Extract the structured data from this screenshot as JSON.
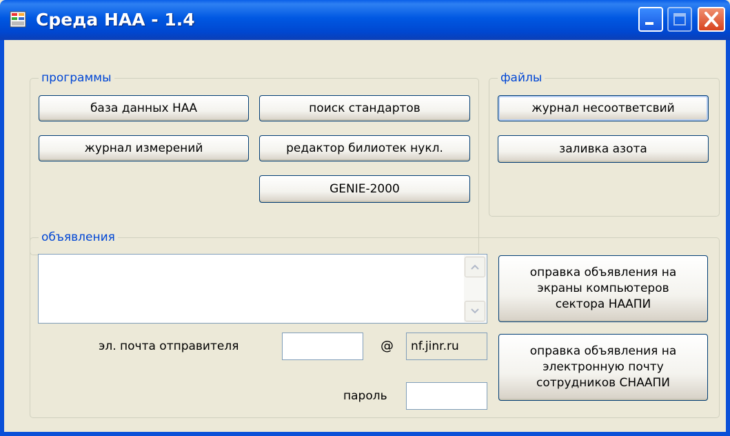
{
  "window": {
    "title": "Среда НАА - 1.4",
    "controls": {
      "minimize": "minimize",
      "maximize": "maximize",
      "close": "close"
    }
  },
  "programs": {
    "legend": "программы",
    "buttons": {
      "naa_database": "база данных НАА",
      "standards_search": "поиск стандартов",
      "measurement_log": "журнал измерений",
      "nuclide_library_editor": "редактор билиотек нукл.",
      "genie": "GENIE-2000"
    }
  },
  "files": {
    "legend": "файлы",
    "buttons": {
      "nonconformity_log": "журнал несоответсвий",
      "nitrogen_fill": "заливка азота"
    }
  },
  "announcements": {
    "legend": "объявления",
    "text_value": "",
    "send_to_screens": "оправка объявления на\nэкраны компьютеров\nсектора НААПИ",
    "send_to_email": "оправка объявления на\nэлектронную почту\nсотрудников СНААПИ",
    "sender_email_label": "эл. почта отправителя",
    "sender_email_value": "",
    "at_sign": "@",
    "domain": "nf.jinr.ru",
    "password_label": "пароль",
    "password_value": ""
  },
  "colors": {
    "titlebar": "#0054e3",
    "legend_text": "#0046d5",
    "background": "#ece9d8"
  }
}
